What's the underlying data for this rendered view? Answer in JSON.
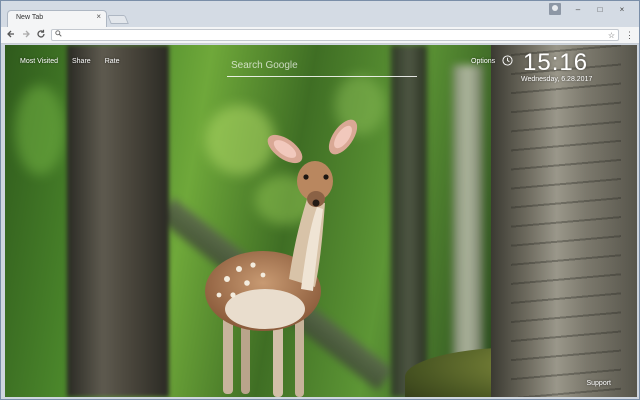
{
  "browser": {
    "tab_title": "New Tab",
    "tab_close": "×",
    "omnibox_value": "",
    "icons": {
      "back": "arrow-left-icon",
      "forward": "arrow-right-icon",
      "reload": "reload-icon",
      "search": "search-icon",
      "star": "star-icon",
      "menu": "menu-dots-icon",
      "profile": "profile-icon"
    },
    "window_controls": {
      "minimize": "–",
      "maximize": "□",
      "close": "×"
    }
  },
  "newtab": {
    "links": [
      "Most Visited",
      "Share",
      "Rate"
    ],
    "search_placeholder": "Search Google",
    "options_label": "Options",
    "clock_time": "15:16",
    "clock_date": "Wednesday, 6.28.2017",
    "support_label": "Support"
  },
  "colors": {
    "chrome_frame": "#d4dbe4",
    "toolbar": "#f4f5f6",
    "overlay_text": "#ffffff"
  }
}
